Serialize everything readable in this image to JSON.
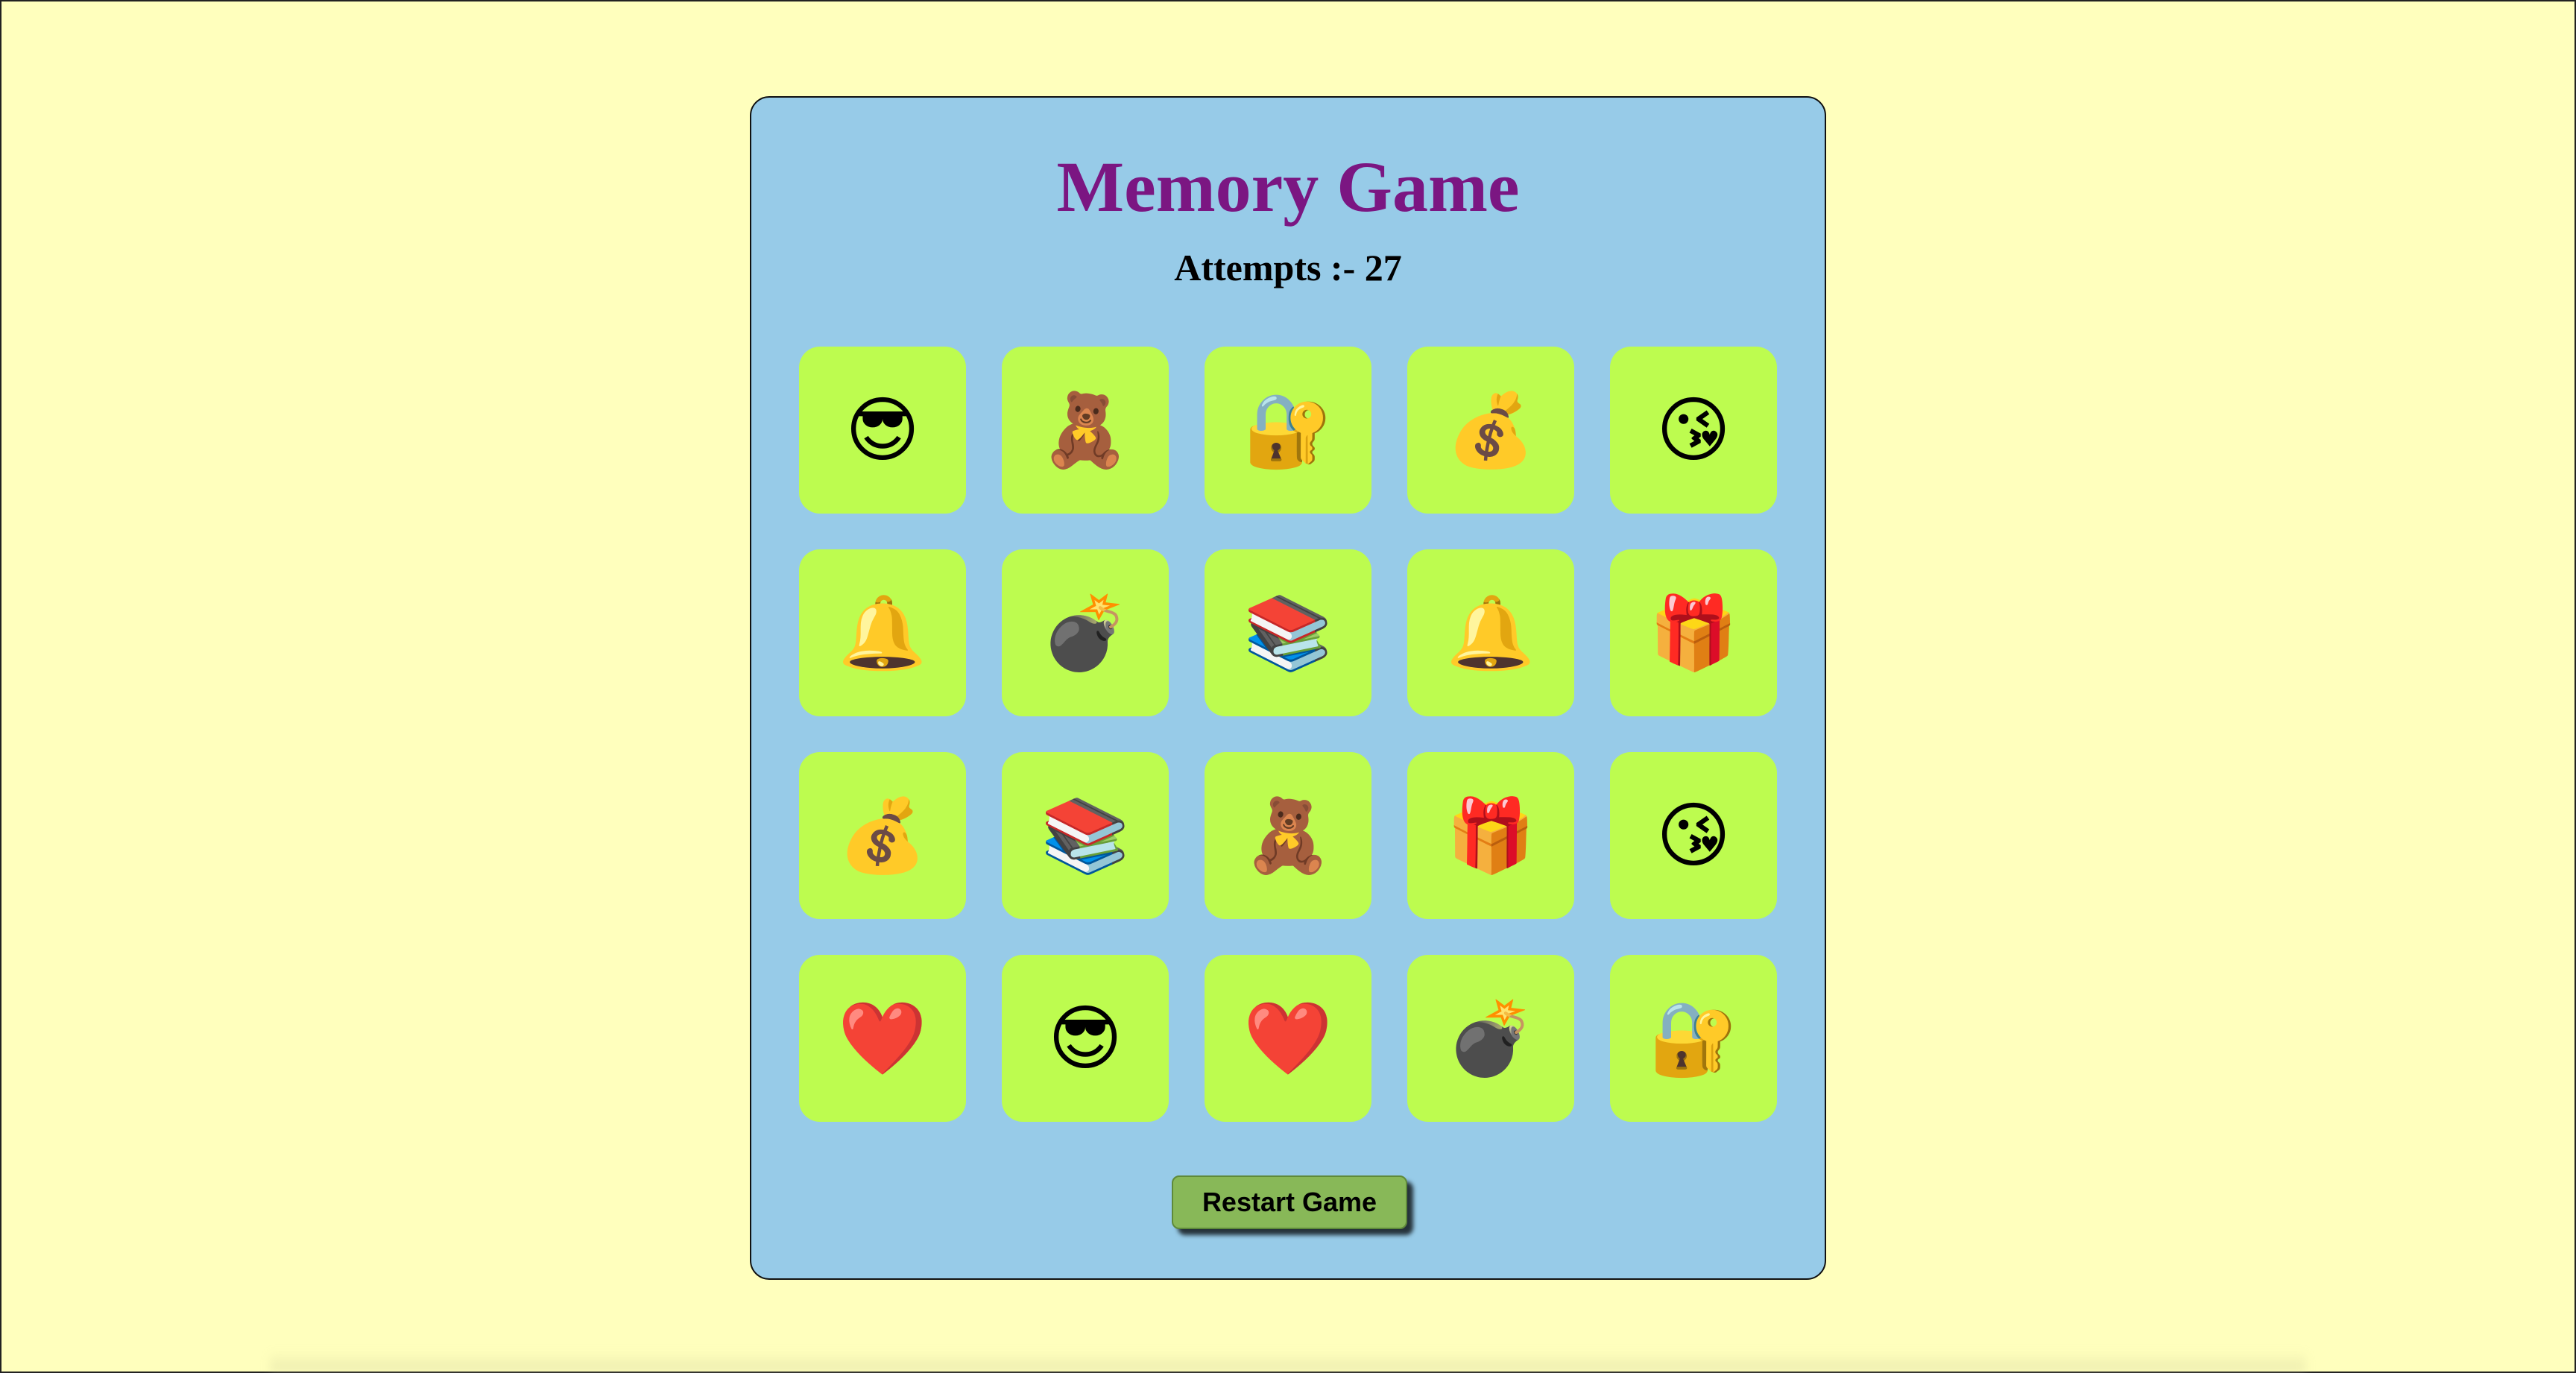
{
  "game": {
    "title": "Memory Game",
    "attempts_label": "Attempts :- 27",
    "restart_label": "Restart Game"
  },
  "colors": {
    "page_background": "#ffffbd",
    "panel_background": "#97cbe8",
    "title": "#7b1682",
    "card": "#bdfc4f",
    "button": "#88b858"
  },
  "cards": [
    {
      "emoji": "😎",
      "name": "sunglasses-face-icon"
    },
    {
      "emoji": "🧸",
      "name": "teddy-bear-icon"
    },
    {
      "emoji": "🔐",
      "name": "lock-with-key-icon"
    },
    {
      "emoji": "💰",
      "name": "money-bag-icon"
    },
    {
      "emoji": "😘",
      "name": "kissing-face-icon"
    },
    {
      "emoji": "🔔",
      "name": "bell-icon"
    },
    {
      "emoji": "💣",
      "name": "bomb-icon"
    },
    {
      "emoji": "📚",
      "name": "books-icon"
    },
    {
      "emoji": "🔔",
      "name": "bell-icon"
    },
    {
      "emoji": "🎁",
      "name": "gift-icon"
    },
    {
      "emoji": "💰",
      "name": "money-bag-icon"
    },
    {
      "emoji": "📚",
      "name": "books-icon"
    },
    {
      "emoji": "🧸",
      "name": "teddy-bear-icon"
    },
    {
      "emoji": "🎁",
      "name": "gift-icon"
    },
    {
      "emoji": "😘",
      "name": "kissing-face-icon"
    },
    {
      "emoji": "❤️",
      "name": "heart-icon"
    },
    {
      "emoji": "😎",
      "name": "sunglasses-face-icon"
    },
    {
      "emoji": "❤️",
      "name": "heart-icon"
    },
    {
      "emoji": "💣",
      "name": "bomb-icon"
    },
    {
      "emoji": "🔐",
      "name": "lock-with-key-icon"
    }
  ]
}
